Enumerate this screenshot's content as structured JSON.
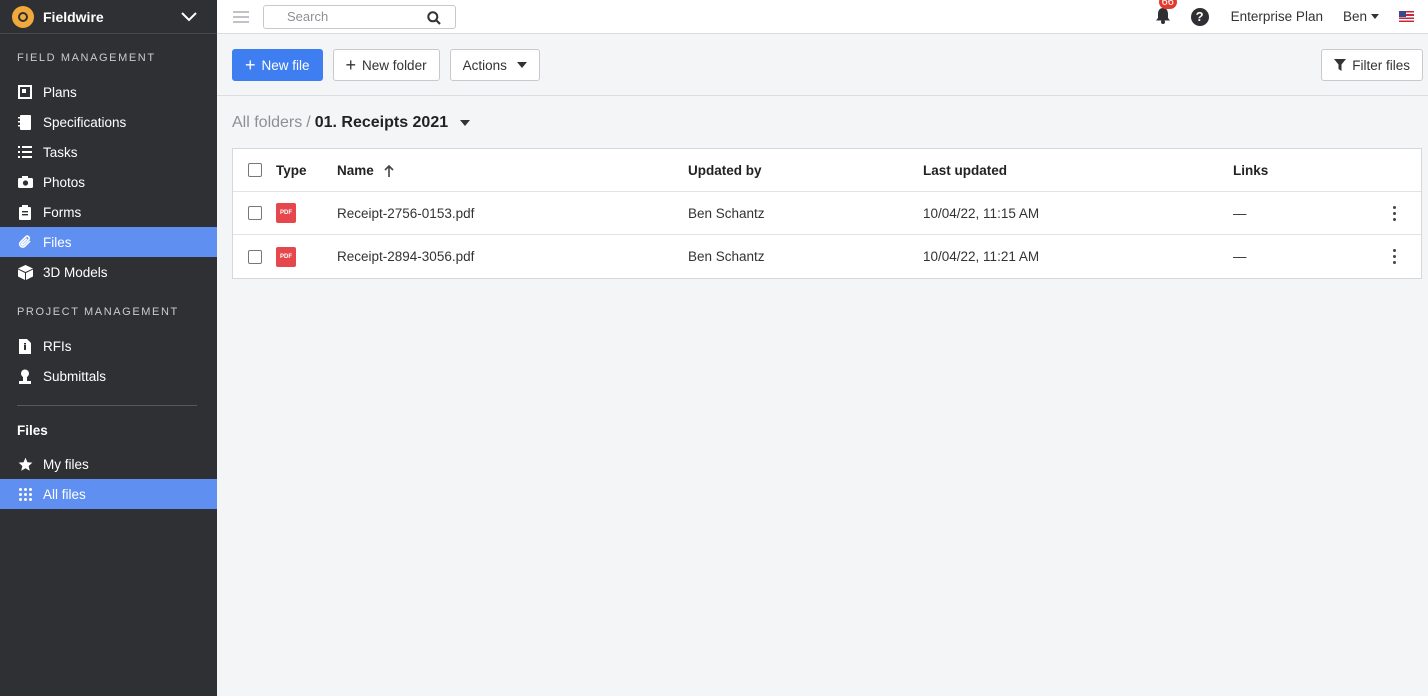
{
  "app": {
    "name": "Fieldwire"
  },
  "sidebar": {
    "sections": [
      {
        "title": "FIELD MANAGEMENT",
        "items": [
          {
            "label": "Plans",
            "icon": "plans-icon"
          },
          {
            "label": "Specifications",
            "icon": "specifications-icon"
          },
          {
            "label": "Tasks",
            "icon": "tasks-icon"
          },
          {
            "label": "Photos",
            "icon": "camera-icon"
          },
          {
            "label": "Forms",
            "icon": "clipboard-icon"
          },
          {
            "label": "Files",
            "icon": "paperclip-icon",
            "active": true
          },
          {
            "label": "3D Models",
            "icon": "cube-icon"
          }
        ]
      },
      {
        "title": "PROJECT MANAGEMENT",
        "items": [
          {
            "label": "RFIs",
            "icon": "rfi-icon"
          },
          {
            "label": "Submittals",
            "icon": "submittals-icon"
          }
        ]
      }
    ],
    "files_group": {
      "title": "Files",
      "items": [
        {
          "label": "My files",
          "icon": "star-icon"
        },
        {
          "label": "All files",
          "icon": "grid-icon",
          "active": true
        }
      ]
    }
  },
  "topbar": {
    "search_placeholder": "Search",
    "notification_count": "66",
    "help_label": "?",
    "plan": "Enterprise Plan",
    "user": "Ben"
  },
  "toolbar": {
    "new_file": "New file",
    "new_folder": "New folder",
    "actions": "Actions",
    "filter_files": "Filter files"
  },
  "breadcrumb": {
    "root": "All folders",
    "separator": "/",
    "current": "01. Receipts 2021"
  },
  "table": {
    "headers": {
      "type": "Type",
      "name": "Name",
      "updated_by": "Updated by",
      "last_updated": "Last updated",
      "links": "Links"
    },
    "rows": [
      {
        "type": "PDF",
        "name": "Receipt-2756-0153.pdf",
        "updated_by": "Ben Schantz",
        "last_updated": "10/04/22, 11:15 AM",
        "links": "—"
      },
      {
        "type": "PDF",
        "name": "Receipt-2894-3056.pdf",
        "updated_by": "Ben Schantz",
        "last_updated": "10/04/22, 11:21 AM",
        "links": "—"
      }
    ]
  },
  "colors": {
    "accent": "#3e7ef0",
    "sidebar_bg": "#2e3033",
    "sidebar_active": "#5f8ff0",
    "badge": "#e23b2e",
    "pdf": "#e5474d"
  }
}
